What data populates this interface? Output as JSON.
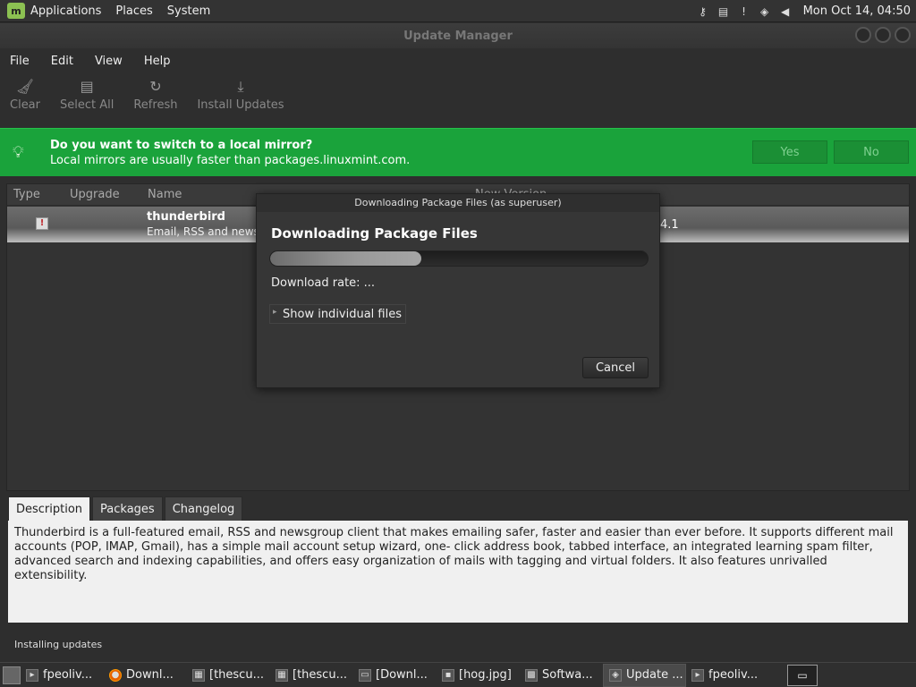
{
  "topbar": {
    "menus": [
      "Applications",
      "Places",
      "System"
    ],
    "clock": "Mon Oct 14, 04:50"
  },
  "window": {
    "title": "Update Manager",
    "menubar": [
      "File",
      "Edit",
      "View",
      "Help"
    ],
    "toolbar": [
      {
        "label": "Clear",
        "icon": "broom-icon"
      },
      {
        "label": "Select All",
        "icon": "document-icon"
      },
      {
        "label": "Refresh",
        "icon": "refresh-icon"
      },
      {
        "label": "Install Updates",
        "icon": "download-icon"
      }
    ]
  },
  "banner": {
    "heading": "Do you want to switch to a local mirror?",
    "text": "Local mirrors are usually faster than packages.linuxmint.com.",
    "yes_label": "Yes",
    "no_label": "No",
    "color": "#1aa33b"
  },
  "list": {
    "columns": [
      "Type",
      "Upgrade",
      "Name",
      "New Version"
    ],
    "rows": [
      {
        "name": "thunderbird",
        "desc": "Email, RSS and news",
        "version": "4.1"
      }
    ]
  },
  "dialog": {
    "title": "Downloading Package Files (as superuser)",
    "heading": "Downloading Package Files",
    "progress": 0.4,
    "rate": "Download rate: ...",
    "expander": "Show individual files",
    "cancel_label": "Cancel"
  },
  "tabs": [
    "Description",
    "Packages",
    "Changelog"
  ],
  "description": "Thunderbird is a full-featured email, RSS and newsgroup client that makes emailing safer, faster and easier than ever before. It supports different mail accounts (POP, IMAP, Gmail), has a simple mail account setup wizard, one- click address book, tabbed interface, an integrated learning spam filter, advanced search and indexing capabilities, and offers easy organization of mails with tagging and virtual folders. It also features unrivalled extensibility.",
  "status": "Installing updates",
  "taskbar": [
    {
      "label": "fpeoliv..."
    },
    {
      "label": "Downl..."
    },
    {
      "label": "[thescu..."
    },
    {
      "label": "[thescu..."
    },
    {
      "label": "[Downl..."
    },
    {
      "label": "[hog.jpg]"
    },
    {
      "label": "Softwa..."
    },
    {
      "label": "Update ..."
    },
    {
      "label": "fpeoliv..."
    }
  ]
}
